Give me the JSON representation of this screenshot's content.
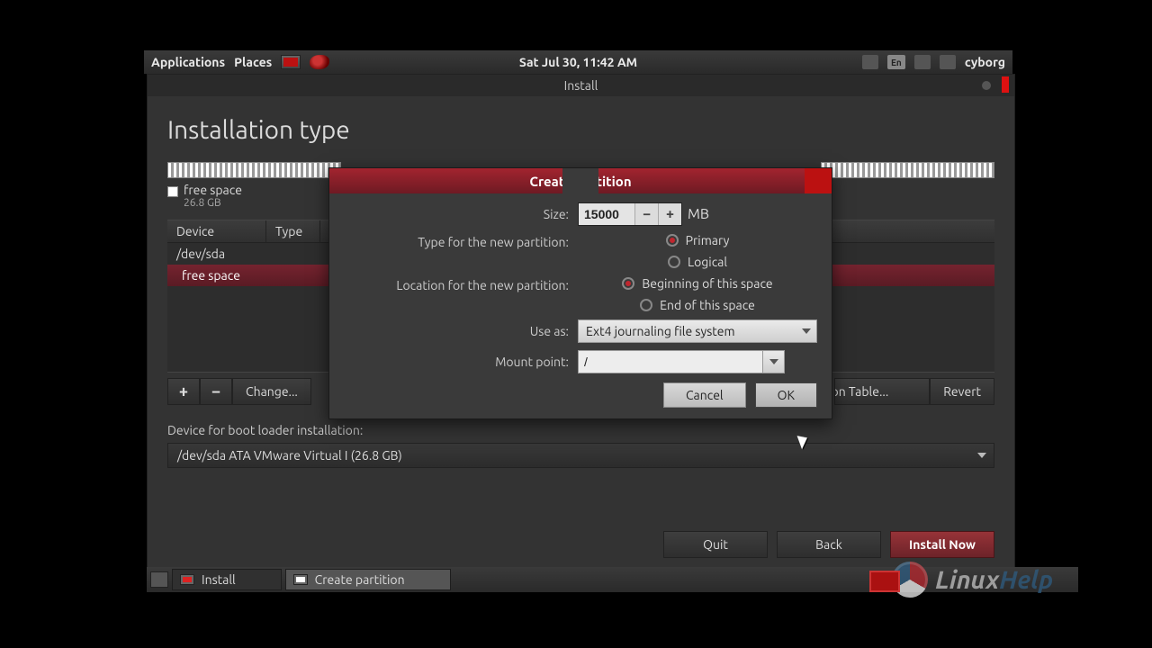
{
  "panel": {
    "applications": "Applications",
    "places": "Places",
    "clock": "Sat Jul 30, 11:42 AM",
    "lang": "En",
    "user": "cyborg"
  },
  "installer": {
    "title": "Install",
    "page_title": "Installation type",
    "free_space_label": "free space",
    "free_space_size": "26.8 GB",
    "columns": {
      "device": "Device",
      "type": "Type"
    },
    "rows": [
      {
        "device": "/dev/sda"
      },
      {
        "device": "free space"
      }
    ],
    "toolbar": {
      "add": "+",
      "remove": "−",
      "change": "Change...",
      "new_table": "New Partition Table...",
      "revert": "Revert"
    },
    "boot_label": "Device for boot loader installation:",
    "boot_value": "/dev/sda  ATA VMware Virtual I (26.8 GB)",
    "buttons": {
      "quit": "Quit",
      "back": "Back",
      "install_now": "Install Now"
    }
  },
  "dialog": {
    "title": "Create partition",
    "size_label": "Size:",
    "size_value": "15000",
    "size_unit": "MB",
    "type_label": "Type for the new partition:",
    "type_opts": {
      "primary": "Primary",
      "logical": "Logical"
    },
    "location_label": "Location for the new partition:",
    "location_opts": {
      "begin": "Beginning of this space",
      "end": "End of this space"
    },
    "useas_label": "Use as:",
    "useas_value": "Ext4 journaling file system",
    "mount_label": "Mount point:",
    "mount_value": "/",
    "cancel": "Cancel",
    "ok": "OK"
  },
  "taskbar": {
    "install": "Install",
    "create": "Create partition"
  },
  "watermark": {
    "a": "Linux",
    "b": "Help"
  }
}
